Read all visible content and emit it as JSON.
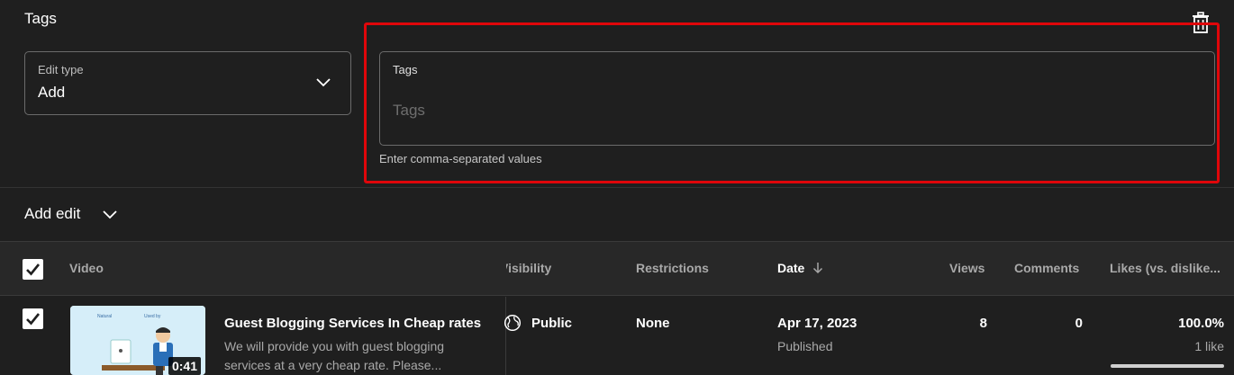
{
  "panel": {
    "title": "Tags",
    "delete_icon": "trash-icon"
  },
  "edit_type": {
    "label": "Edit type",
    "value": "Add"
  },
  "tags_field": {
    "label": "Tags",
    "value": "",
    "placeholder": "Tags",
    "hint": "Enter comma-separated values"
  },
  "add_edit": {
    "label": "Add edit"
  },
  "table": {
    "columns": {
      "video": "Video",
      "visibility": "Visibility",
      "restrictions": "Restrictions",
      "date": "Date",
      "views": "Views",
      "comments": "Comments",
      "likes": "Likes (vs. dislike..."
    },
    "rows": [
      {
        "duration": "0:41",
        "title": "Guest Blogging Services In Cheap rates",
        "description": "We will provide you with guest blogging services at a very cheap rate. Please...",
        "visibility": "Public",
        "restrictions": "None",
        "date": "Apr 17, 2023",
        "date_status": "Published",
        "views": "8",
        "comments": "0",
        "likes_pct": "100.0%",
        "likes_count": "1 like",
        "likes_ratio": 1.0
      }
    ]
  },
  "colors": {
    "background": "#1f1f1f",
    "highlight": "#e0060a"
  }
}
